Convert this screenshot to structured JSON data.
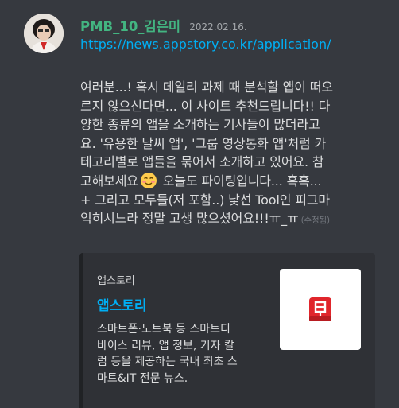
{
  "message": {
    "username": "PMB_10_김은미",
    "timestamp": "2022.02.16.",
    "link": "https://news.appstory.co.kr/application/",
    "body_lines": [
      "여러분...! 혹시 데일리 과제 때 분석할 앱이 떠오",
      "르지 않으신다면... 이 사이트 추천드립니다!! 다",
      "양한 종류의 앱을 소개하는 기사들이 많더라고",
      "요. '유용한 날씨 앱', '그룹 영상통화 앱'처럼 카",
      "테고리별로 앱들을 묶어서 소개하고 있어요. 참"
    ],
    "line6_before_emoji": "고해보세요",
    "line6_after_emoji": " 오늘도 파이팅입니다... 흑흑...",
    "body_line7": "+ 그리고 모두들(저 포함..) 낯선 Tool인 피그마",
    "body_line8": "익히시느라 정말 고생 많으셨어요!!!ㅠ_ㅠ",
    "edited_label": "(수정됨)",
    "emoji_icon": "smiling-face-with-blush-emoji"
  },
  "embed": {
    "provider": "앱스토리",
    "title": "앱스토리",
    "description_lines": [
      "스마트폰·노트북 등 스마트디",
      "바이스 리뷰, 앱 정보, 기자 칼",
      "럼 등을 제공하는 국내 최초 스",
      "마트&IT 전문 뉴스."
    ],
    "thumbnail_icon": "appstory-logo-icon",
    "accent_color": "#e0262c"
  },
  "colors": {
    "background": "#36393f",
    "username": "#43b581",
    "link": "#00aff4",
    "embed_bg": "#2f3136"
  }
}
